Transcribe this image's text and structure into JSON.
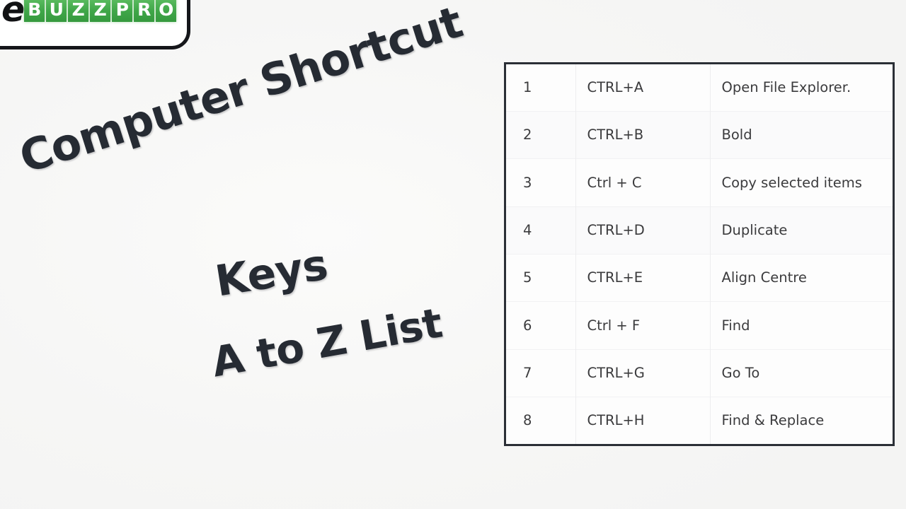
{
  "logo": {
    "prefix": "e",
    "tiles": [
      "B",
      "U",
      "Z",
      "Z",
      "P",
      "R",
      "O"
    ],
    "accent_color": "#3fa648",
    "text_color": "#ffffff",
    "prefix_color": "#111214",
    "border_color": "#15161a"
  },
  "headline": {
    "line1": "Computer Shortcut",
    "line2": "Keys",
    "line3": "A to Z List",
    "color": "#262b33"
  },
  "table": {
    "border_color": "#2b2f36",
    "text_color": "#3b3b3d",
    "rows": [
      {
        "index": "1",
        "keys": "CTRL+A",
        "description": "Open File Explorer."
      },
      {
        "index": "2",
        "keys": "CTRL+B",
        "description": "Bold"
      },
      {
        "index": "3",
        "keys": "Ctrl + C",
        "description": "Copy selected items"
      },
      {
        "index": "4",
        "keys": "CTRL+D",
        "description": "Duplicate"
      },
      {
        "index": "5",
        "keys": "CTRL+E",
        "description": "Align Centre"
      },
      {
        "index": "6",
        "keys": "Ctrl + F",
        "description": "Find"
      },
      {
        "index": "7",
        "keys": "CTRL+G",
        "description": "Go To"
      },
      {
        "index": "8",
        "keys": "CTRL+H",
        "description": "Find & Replace"
      }
    ]
  },
  "background_color": "#f6f6f5"
}
